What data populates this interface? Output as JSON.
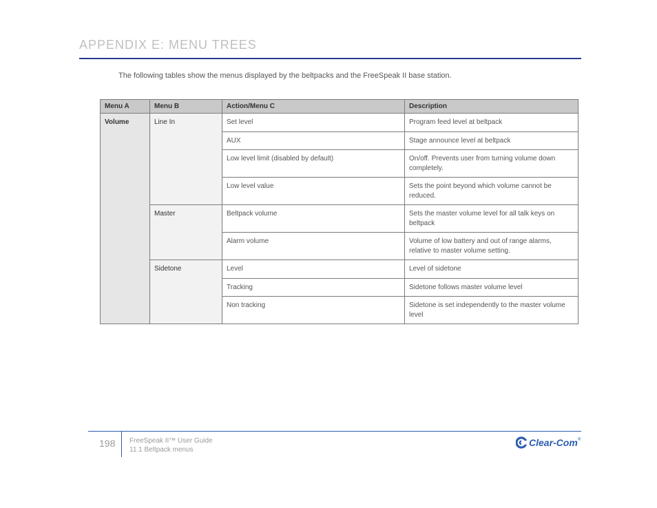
{
  "title": "APPENDIX E: MENU TREES",
  "intro": "The following tables show the menus displayed by the beltpacks and the FreeSpeak II base station.",
  "table": {
    "headers": [
      "Menu A",
      "Menu B",
      "Action/Menu C",
      "Description"
    ],
    "rows": [
      {
        "a": "Volume",
        "b": "Line In",
        "c": "Set level",
        "d": "Program feed level at beltpack",
        "a_rowspan": 9,
        "b_rowspan": 4
      },
      {
        "c": "AUX",
        "d": "Stage announce level at beltpack"
      },
      {
        "c": "Low level limit (disabled by default)",
        "d": "On/off. Prevents user from turning volume down completely."
      },
      {
        "c": "Low level value",
        "d": "Sets the point beyond which volume cannot be reduced."
      },
      {
        "b": "Master",
        "c": "Beltpack volume",
        "d": "Sets the master volume level for all talk keys on beltpack",
        "b_rowspan": 2
      },
      {
        "c": "Alarm volume",
        "d": "Volume of low battery and out of range alarms, relative to master volume setting."
      },
      {
        "b": "Sidetone",
        "c": "Level",
        "d": "Level of sidetone",
        "b_rowspan": 3
      },
      {
        "c": "Tracking",
        "d": "Sidetone follows master volume level"
      },
      {
        "c": "Non tracking",
        "d": "Sidetone is set independently to the master volume level"
      }
    ]
  },
  "footer": {
    "page": "198",
    "line1": "FreeSpeak II™ User Guide",
    "line2": "11.1 Beltpack menus"
  },
  "brand": {
    "name": "Clear-Com",
    "registered": "®"
  }
}
